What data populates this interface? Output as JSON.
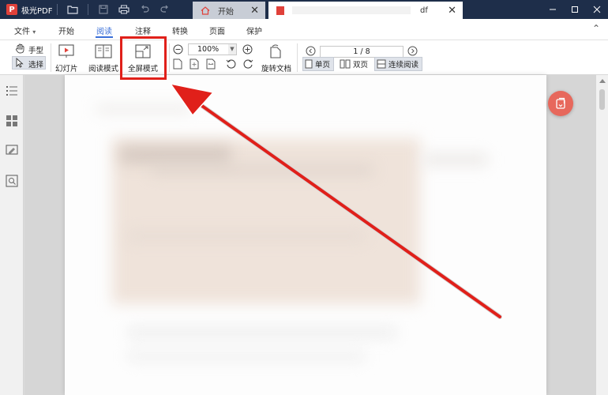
{
  "window": {
    "app_name": "极光PDF",
    "logo_letter": "P",
    "tabs": [
      {
        "label": "开始"
      },
      {
        "label": "df"
      }
    ]
  },
  "menu": {
    "items": [
      "文件",
      "开始",
      "阅读",
      "注释",
      "转换",
      "页面",
      "保护"
    ],
    "active": "阅读",
    "file_caret": "▾",
    "collapse": "⌃"
  },
  "toolbar": {
    "hand_label": "手型",
    "select_label": "选择",
    "slideshow_label": "幻灯片",
    "reading_mode_label": "阅读模式",
    "fullscreen_label": "全屏模式",
    "zoom_value": "100%",
    "rotate_doc_label": "旋转文档",
    "page_indicator": "1 / 8",
    "single_page_label": "单页",
    "double_page_label": "双页",
    "continuous_label": "连续阅读"
  },
  "colors": {
    "titlebar": "#1e2e4a",
    "accent": "#3a6fd8",
    "annotation_red": "#e0201a",
    "fab": "#e7685c"
  },
  "icons": [
    "pdf-logo-icon",
    "folder-icon",
    "save-icon",
    "print-icon",
    "undo-icon",
    "redo-icon",
    "home-icon",
    "pdf-file-icon",
    "close-icon",
    "minimize-icon",
    "restore-icon",
    "window-close-icon",
    "hand-icon",
    "cursor-icon",
    "slideshow-icon",
    "book-icon",
    "fullscreen-icon",
    "zoom-out-icon",
    "zoom-in-icon",
    "rotate-left-icon",
    "rotate-right-icon",
    "rotate-document-icon",
    "prev-page-icon",
    "next-page-icon",
    "outline-icon",
    "thumbnails-icon",
    "annotations-icon",
    "search-icon"
  ]
}
